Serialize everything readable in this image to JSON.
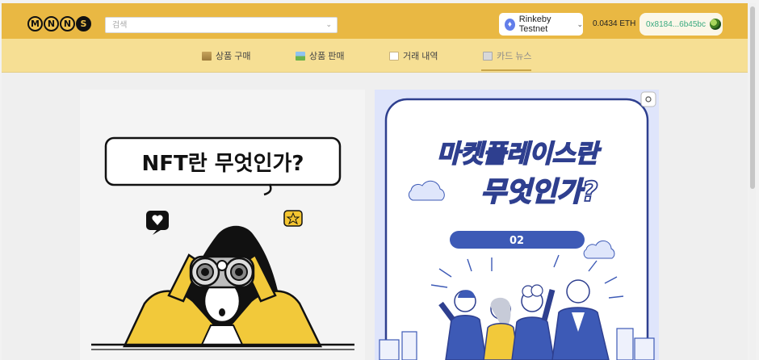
{
  "header": {
    "logo_letters": [
      "M",
      "N",
      "N",
      "S"
    ],
    "search_placeholder": "검색",
    "network": "Rinkeby Testnet",
    "balance": "0.0434 ETH",
    "wallet_address": "0x8184...6b45bc"
  },
  "nav": {
    "items": [
      {
        "label": "상품 구매",
        "icon": "cart-icon"
      },
      {
        "label": "상품 판매",
        "icon": "picture-icon"
      },
      {
        "label": "거래 내역",
        "icon": "document-icon"
      },
      {
        "label": "카드 뉴스",
        "icon": "newspaper-icon",
        "active": true
      }
    ]
  },
  "cards": [
    {
      "title": "NFT란 무엇인가?"
    },
    {
      "title_line1": "마켓플레이스란",
      "title_line2": "무엇인가?",
      "badge": "02"
    }
  ],
  "colors": {
    "header": "#e9b843",
    "nav": "#f6df94",
    "wallet_text": "#39a97f",
    "card_right_bg": "#dfe5fb",
    "card_right_accent": "#3d5ab6"
  }
}
